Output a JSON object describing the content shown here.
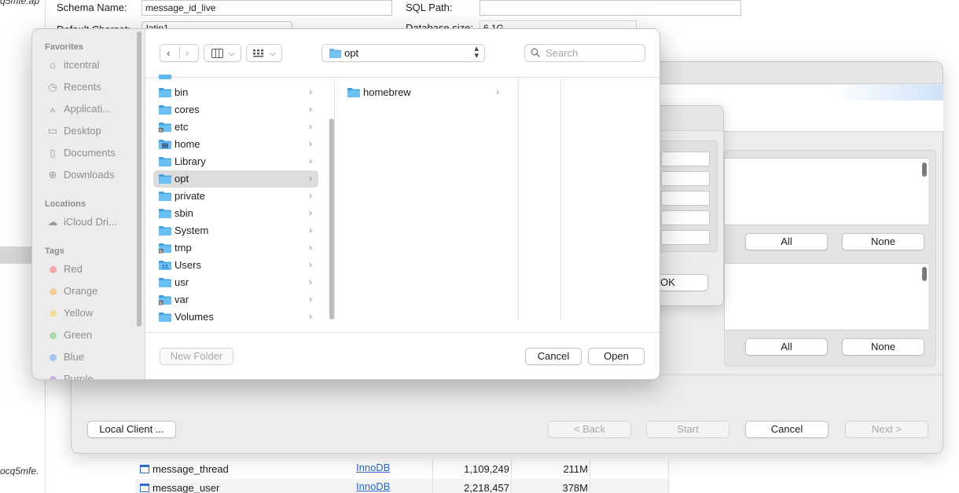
{
  "background": {
    "left_fragments": [
      "q5mfe.ap",
      "ocq5mfe."
    ],
    "schema_label": "Schema Name:",
    "schema_value": "message_id_live",
    "sqlpath_label": "SQL Path:",
    "sqlpath_value": "",
    "charset_label": "Default Charset:",
    "charset_value": "latin1",
    "dbsize_label": "Database size:",
    "dbsize_value": "6.1G",
    "tables": [
      {
        "name": "message_thread",
        "engine": "InnoDB",
        "rows": "1,109,249",
        "size": "211M"
      },
      {
        "name": "message_user",
        "engine": "InnoDB",
        "rows": "2,218,457",
        "size": "378M"
      }
    ]
  },
  "wizard": {
    "all_label": "All",
    "none_label": "None",
    "local_client_label": "Local Client ...",
    "back_label": "< Back",
    "start_label": "Start",
    "cancel_label": "Cancel",
    "next_label": "Next >"
  },
  "connection_dialog": {
    "ok_label": "OK"
  },
  "file_panel": {
    "sidebar": {
      "favorites_header": "Favorites",
      "favorites": [
        {
          "label": "itcentral",
          "icon": "home-icon"
        },
        {
          "label": "Recents",
          "icon": "clock-icon"
        },
        {
          "label": "Applicati...",
          "icon": "applications-icon"
        },
        {
          "label": "Desktop",
          "icon": "desktop-icon"
        },
        {
          "label": "Documents",
          "icon": "document-icon"
        },
        {
          "label": "Downloads",
          "icon": "download-icon"
        }
      ],
      "locations_header": "Locations",
      "locations": [
        {
          "label": "iCloud Dri...",
          "icon": "cloud-icon"
        }
      ],
      "tags_header": "Tags",
      "tags": [
        {
          "label": "Red",
          "color": "#f3a7a4"
        },
        {
          "label": "Orange",
          "color": "#f6c99a"
        },
        {
          "label": "Yellow",
          "color": "#f3dd9a"
        },
        {
          "label": "Green",
          "color": "#a9dcaa"
        },
        {
          "label": "Blue",
          "color": "#a2c6f3"
        },
        {
          "label": "Purple",
          "color": "#d6a9e2"
        }
      ]
    },
    "toolbar": {
      "back_icon": "chevron-left-icon",
      "forward_icon": "chevron-right-icon",
      "view_icon": "columns-view-icon",
      "group_icon": "grid-group-icon",
      "current_folder": "opt",
      "search_placeholder": "Search"
    },
    "column1": [
      {
        "name": "bin",
        "type": "folder"
      },
      {
        "name": "cores",
        "type": "folder"
      },
      {
        "name": "etc",
        "type": "alias"
      },
      {
        "name": "home",
        "type": "server"
      },
      {
        "name": "Library",
        "type": "folder"
      },
      {
        "name": "opt",
        "type": "folder",
        "selected": true
      },
      {
        "name": "private",
        "type": "folder"
      },
      {
        "name": "sbin",
        "type": "folder"
      },
      {
        "name": "System",
        "type": "folder"
      },
      {
        "name": "tmp",
        "type": "alias"
      },
      {
        "name": "Users",
        "type": "users"
      },
      {
        "name": "usr",
        "type": "folder"
      },
      {
        "name": "var",
        "type": "alias"
      },
      {
        "name": "Volumes",
        "type": "folder"
      }
    ],
    "column2": [
      {
        "name": "homebrew",
        "type": "folder"
      }
    ],
    "new_folder_label": "New Folder",
    "cancel_label": "Cancel",
    "open_label": "Open",
    "colors": {
      "folder": "#5cb5ec",
      "folder_dark": "#3e9ede",
      "selection": "#dcdcdc"
    }
  }
}
